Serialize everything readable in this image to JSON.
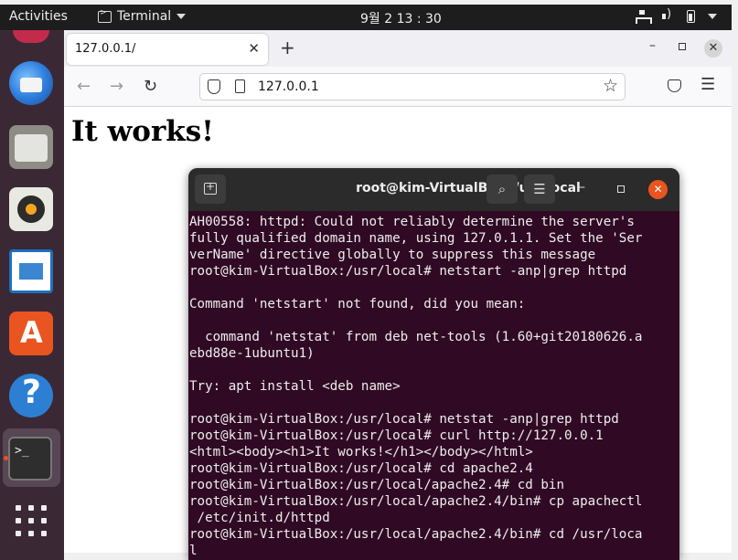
{
  "topbar": {
    "activities": "Activities",
    "app_menu": "Terminal",
    "clock": "9월 2  13 : 30"
  },
  "dock": {
    "apps": [
      "Firefox",
      "Thunderbird",
      "Files",
      "Rhythmbox",
      "LibreOffice Writer",
      "Ubuntu Software",
      "Help",
      "Terminal",
      "Show Applications"
    ],
    "active_app": "Terminal",
    "accent_color": "#e95420"
  },
  "browser": {
    "tab_title": "127.0.0.1/",
    "url": "127.0.0.1",
    "page_heading": "It works!",
    "icons": {
      "back": "arrow-left-icon",
      "forward": "arrow-right-icon",
      "reload": "reload-icon",
      "tracking": "shield-icon",
      "page": "page-icon",
      "bookmark": "star-icon",
      "pocket": "pocket-icon",
      "menu": "hamburger-menu-icon"
    }
  },
  "terminal": {
    "title": "root@kim-VirtualBox: /usr/local",
    "background_color": "#300a24",
    "lines": [
      "AH00558: httpd: Could not reliably determine the server's",
      "fully qualified domain name, using 127.0.1.1. Set the 'Ser",
      "verName' directive globally to suppress this message",
      "root@kim-VirtualBox:/usr/local# netstart -anp|grep httpd",
      "",
      "Command 'netstart' not found, did you mean:",
      "",
      "  command 'netstat' from deb net-tools (1.60+git20180626.a",
      "ebd88e-1ubuntu1)",
      "",
      "Try: apt install <deb name>",
      "",
      "root@kim-VirtualBox:/usr/local# netstat -anp|grep httpd",
      "root@kim-VirtualBox:/usr/local# curl http://127.0.0.1",
      "<html><body><h1>It works!</h1></body></html>",
      "root@kim-VirtualBox:/usr/local# cd apache2.4",
      "root@kim-VirtualBox:/usr/local/apache2.4# cd bin",
      "root@kim-VirtualBox:/usr/local/apache2.4/bin# cp apachectl",
      " /etc/init.d/httpd",
      "root@kim-VirtualBox:/usr/local/apache2.4/bin# cd /usr/loca",
      "l"
    ]
  }
}
